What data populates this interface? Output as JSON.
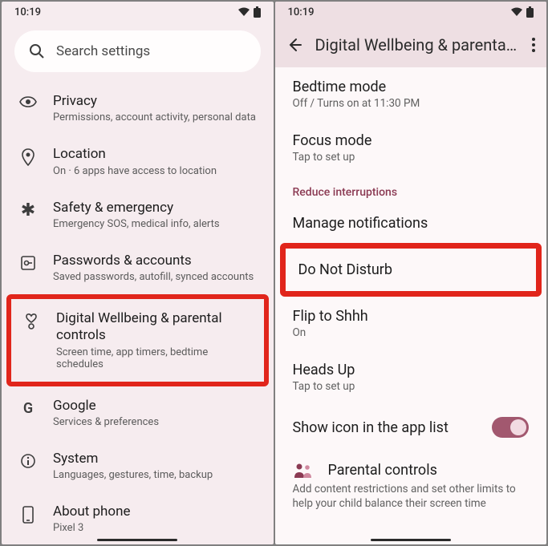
{
  "status": {
    "time": "10:19"
  },
  "left": {
    "search_placeholder": "Search settings",
    "items": [
      {
        "icon": "eye-icon",
        "title": "Privacy",
        "sub": "Permissions, account activity, personal data"
      },
      {
        "icon": "location-icon",
        "title": "Location",
        "sub": "On · 6 apps have access to location"
      },
      {
        "icon": "asterisk-icon",
        "title": "Safety & emergency",
        "sub": "Emergency SOS, medical info, alerts"
      },
      {
        "icon": "key-icon",
        "title": "Passwords & accounts",
        "sub": "Saved passwords, autofill, synced accounts"
      },
      {
        "icon": "wellbeing-icon",
        "title": "Digital Wellbeing & parental controls",
        "sub": "Screen time, app timers, bedtime schedules",
        "highlight": true
      },
      {
        "icon": "google-icon",
        "title": "Google",
        "sub": "Services & preferences"
      },
      {
        "icon": "info-icon",
        "title": "System",
        "sub": "Languages, gestures, time, backup"
      },
      {
        "icon": "phone-icon",
        "title": "About phone",
        "sub": "Pixel 3"
      }
    ]
  },
  "right": {
    "appbar_title": "Digital Wellbeing & parental...",
    "items": [
      {
        "title": "Bedtime mode",
        "sub": "Off / Turns on at 11:30 PM"
      },
      {
        "title": "Focus mode",
        "sub": "Tap to set up"
      }
    ],
    "section_label": "Reduce interruptions",
    "items2": [
      {
        "title": "Manage notifications"
      },
      {
        "title": "Do Not Disturb",
        "highlight": true
      },
      {
        "title": "Flip to Shhh",
        "sub": "On"
      },
      {
        "title": "Heads Up",
        "sub": "Tap to set up"
      }
    ],
    "toggle_label": "Show icon in the app list",
    "parental_title": "Parental controls",
    "parental_desc": "Add content restrictions and set other limits to help your child balance their screen time"
  }
}
